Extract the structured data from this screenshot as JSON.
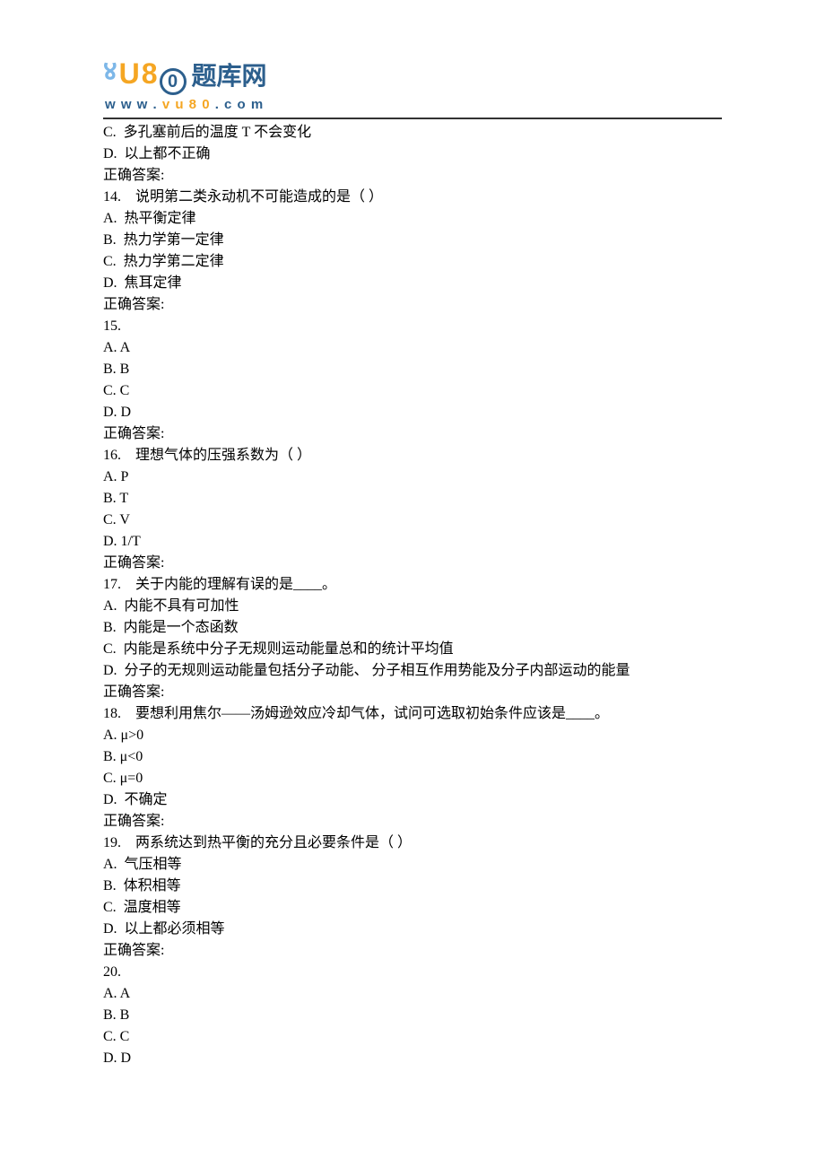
{
  "logo": {
    "text_cn": "题库网",
    "url_display": "www.vu80.com"
  },
  "lines": [
    "C.  多孔塞前后的温度 T 不会变化",
    "D.  以上都不正确",
    "正确答案:",
    "14.    说明第二类永动机不可能造成的是（ ）",
    "A.  热平衡定律",
    "B.  热力学第一定律",
    "C.  热力学第二定律",
    "D.  焦耳定律",
    "正确答案:",
    "15.",
    "A. A",
    "B. B",
    "C. C",
    "D. D",
    "正确答案:",
    "16.    理想气体的压强系数为（ ）",
    "A. P",
    "B. T",
    "C. V",
    "D. 1/T",
    "正确答案:",
    "17.    关于内能的理解有误的是____。",
    "A.  内能不具有可加性",
    "B.  内能是一个态函数",
    "C.  内能是系统中分子无规则运动能量总和的统计平均值",
    "D.  分子的无规则运动能量包括分子动能、 分子相互作用势能及分子内部运动的能量",
    "正确答案:",
    "18.    要想利用焦尔——汤姆逊效应冷却气体，试问可选取初始条件应该是____。",
    "A. μ>0",
    "B. μ<0",
    "C. μ=0",
    "D.  不确定",
    "正确答案:",
    "19.    两系统达到热平衡的充分且必要条件是（ ）",
    "A.  气压相等",
    "B.  体积相等",
    "C.  温度相等",
    "D.  以上都必须相等",
    "正确答案:",
    "20.",
    "A. A",
    "B. B",
    "C. C",
    "D. D"
  ]
}
